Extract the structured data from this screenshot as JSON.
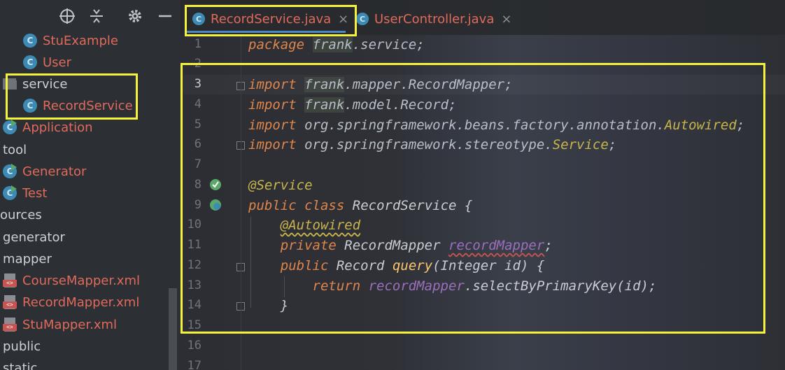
{
  "sidebar": {
    "toolbar_icons": [
      "crosshair-icon",
      "collapse-icon",
      "gear-icon",
      "minimize-icon"
    ],
    "items": [
      {
        "label": "StuExample",
        "icon": "class-icon",
        "color": "red"
      },
      {
        "label": "User",
        "icon": "class-icon",
        "color": "red"
      },
      {
        "label": "service",
        "icon": "folder-icon",
        "color": "plain"
      },
      {
        "label": "RecordService",
        "icon": "class-icon",
        "color": "red"
      },
      {
        "label": "Application",
        "icon": "spring-run-icon",
        "color": "red"
      },
      {
        "label": "tool",
        "icon": "none",
        "color": "plain"
      },
      {
        "label": "Generator",
        "icon": "run-class-icon",
        "color": "red"
      },
      {
        "label": "Test",
        "icon": "run-class-icon",
        "color": "red"
      },
      {
        "label": "ources",
        "icon": "none",
        "color": "plain"
      },
      {
        "label": "generator",
        "icon": "none",
        "color": "plain"
      },
      {
        "label": "mapper",
        "icon": "none",
        "color": "plain"
      },
      {
        "label": "CourseMapper.xml",
        "icon": "xml-icon",
        "color": "red"
      },
      {
        "label": "RecordMapper.xml",
        "icon": "xml-icon",
        "color": "red"
      },
      {
        "label": "StuMapper.xml",
        "icon": "xml-icon",
        "color": "red"
      },
      {
        "label": "public",
        "icon": "none",
        "color": "plain"
      },
      {
        "label": "static",
        "icon": "none",
        "color": "plain"
      }
    ]
  },
  "tabs": [
    {
      "label": "RecordService.java",
      "close": "×",
      "active": true
    },
    {
      "label": "UserController.java",
      "close": "×",
      "active": false
    }
  ],
  "class_icon_letter": "C",
  "xml_icon_text": "<>",
  "editor": {
    "current_line": 3,
    "line_numbers": [
      "1",
      "2",
      "3",
      "4",
      "5",
      "6",
      "7",
      "8",
      "9",
      "10",
      "11",
      "12",
      "13",
      "14",
      "15",
      "16",
      "17"
    ],
    "lines": {
      "l1": {
        "kw": "package",
        "rest_hl": "frank",
        "rest": ".service;"
      },
      "l3": {
        "kw": "import",
        "rest_hl": "frank",
        "rest": ".mapper.RecordMapper;"
      },
      "l4": {
        "kw": "import",
        "rest_hl": "frank",
        "rest": ".model.Record;"
      },
      "l5": {
        "kw": "import",
        "rest": "org.springframework.beans.factory.annotation.",
        "ann": "Autowired",
        "tail": ";"
      },
      "l6": {
        "kw": "import",
        "rest": "org.springframework.stereotype.",
        "ann": "Service",
        "tail": ";"
      },
      "l8": {
        "ann": "@Service"
      },
      "l9": {
        "kw1": "public",
        "kw2": "class",
        "name": "RecordService",
        "tail": "{"
      },
      "l10": {
        "ann": "@Autowired"
      },
      "l11": {
        "kw": "private",
        "type": "RecordMapper",
        "field": "recordMapper",
        "tail": ";"
      },
      "l12": {
        "kw": "public",
        "type": "Record",
        "method": "query",
        "params_a": "(",
        "param_type": "Integer",
        "param": "id",
        "params_b": ") {"
      },
      "l13": {
        "kw": "return",
        "field": "recordMapper",
        "call": ".selectByPrimaryKey(id);"
      },
      "l14": {
        "tail": "}"
      }
    }
  },
  "colors": {
    "highlight_box": "#f5f23b",
    "keyword": "#e0864b",
    "annotation": "#c9b64b",
    "field": "#9b6fbd",
    "method": "#ffc66d",
    "tree_red": "#e06a5b"
  }
}
